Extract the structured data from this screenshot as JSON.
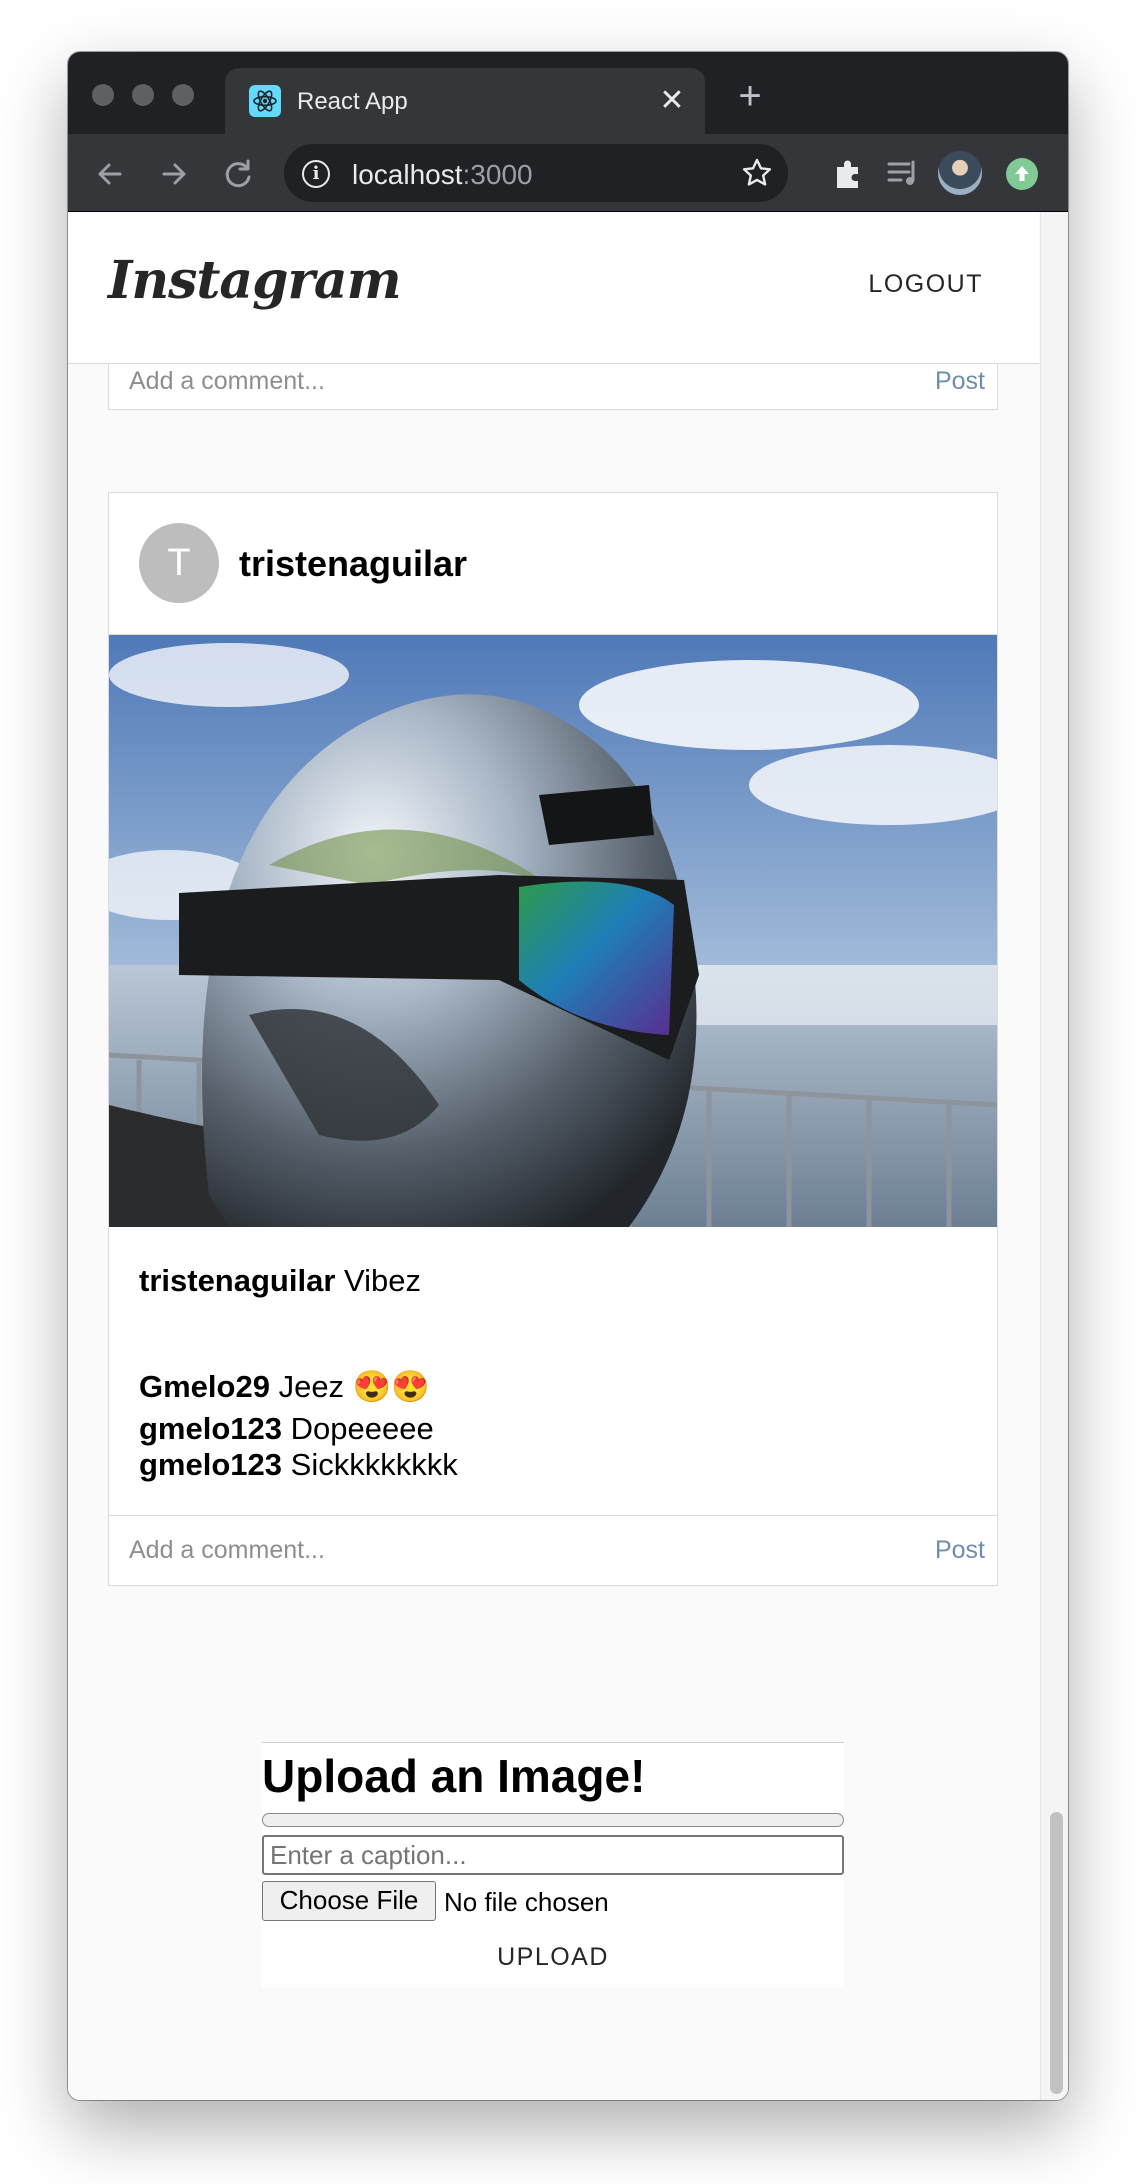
{
  "browser": {
    "tab_title": "React App",
    "url_host": "localhost",
    "url_port": ":3000"
  },
  "app": {
    "logo": "Instagram",
    "logout_label": "LOGOUT"
  },
  "previous_post": {
    "comment_placeholder": "Add a comment...",
    "post_label": "Post"
  },
  "post": {
    "avatar_letter": "T",
    "username": "tristenaguilar",
    "caption_user": "tristenaguilar",
    "caption_text": "Vibez",
    "comments": [
      {
        "user": "Gmelo29",
        "text": "Jeez 😍😍"
      },
      {
        "user": "gmelo123",
        "text": "Dopeeeee"
      },
      {
        "user": "gmelo123",
        "text": "Sickkkkkkkk"
      }
    ],
    "comment_placeholder": "Add a comment...",
    "post_label": "Post"
  },
  "upload": {
    "title": "Upload an Image!",
    "progress": 0,
    "caption_placeholder": "Enter a caption...",
    "file_button": "Choose File",
    "file_status": "No file chosen",
    "upload_label": "UPLOAD"
  }
}
